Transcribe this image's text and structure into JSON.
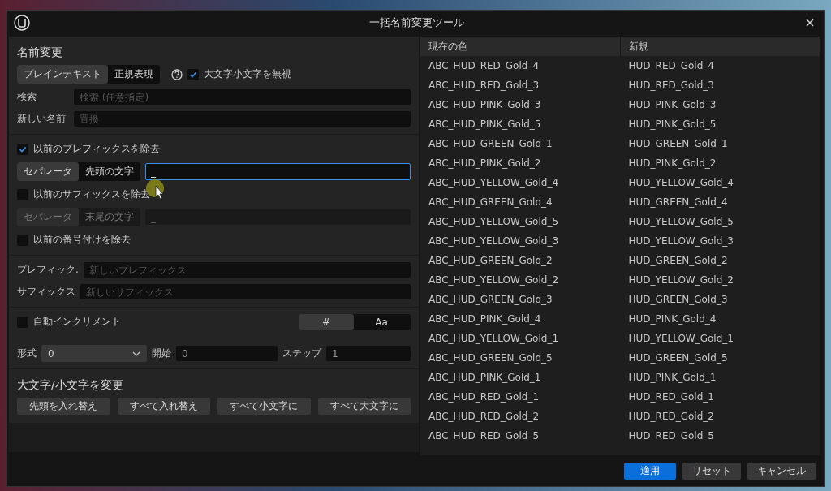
{
  "window": {
    "title": "一括名前変更ツール"
  },
  "rename": {
    "heading": "名前変更",
    "modes": [
      {
        "label": "プレインテキスト",
        "selected": true
      },
      {
        "label": "正規表現",
        "selected": false
      }
    ],
    "ignore_case": {
      "label": "大文字小文字を無視",
      "checked": true
    },
    "fields": [
      {
        "label": "検索",
        "placeholder": "検索 (任意指定)"
      },
      {
        "label": "新しい名前",
        "placeholder": "置換"
      }
    ]
  },
  "remove_prefix": {
    "label": "以前のプレフィックスを除去",
    "checked": true,
    "modes": [
      {
        "label": "セパレータ",
        "selected": true
      },
      {
        "label": "先頭の文字",
        "selected": false
      }
    ],
    "value": "_",
    "focused": true
  },
  "remove_suffix": {
    "label": "以前のサフィックスを除去",
    "checked": false,
    "modes": [
      {
        "label": "セパレータ",
        "selected": true
      },
      {
        "label": "末尾の文字",
        "selected": false
      }
    ],
    "value": "_",
    "focused": false
  },
  "remove_numbering": {
    "label": "以前の番号付けを除去",
    "checked": false
  },
  "affix_fields": [
    {
      "label": "プレフィック.",
      "placeholder": "新しいプレフィックス"
    },
    {
      "label": "サフィックス",
      "placeholder": "新しいサフィックス"
    }
  ],
  "auto_increment": {
    "label": "自動インクリメント",
    "checked": false,
    "modes": [
      {
        "label": "#",
        "selected": true
      },
      {
        "label": "Aa",
        "selected": false
      }
    ],
    "format": {
      "label": "形式",
      "value": "0"
    },
    "start": {
      "label": "開始",
      "value": "0"
    },
    "step": {
      "label": "ステップ",
      "value": "1"
    }
  },
  "case_change": {
    "heading": "大文字/小文字を変更",
    "buttons": [
      "先頭を入れ替え",
      "すべて入れ替え",
      "すべて小文字に",
      "すべて大文字に"
    ]
  },
  "table": {
    "columns": [
      "現在の色",
      "新規"
    ],
    "rows": [
      [
        "ABC_HUD_RED_Gold_4",
        "HUD_RED_Gold_4"
      ],
      [
        "ABC_HUD_RED_Gold_3",
        "HUD_RED_Gold_3"
      ],
      [
        "ABC_HUD_PINK_Gold_3",
        "HUD_PINK_Gold_3"
      ],
      [
        "ABC_HUD_PINK_Gold_5",
        "HUD_PINK_Gold_5"
      ],
      [
        "ABC_HUD_GREEN_Gold_1",
        "HUD_GREEN_Gold_1"
      ],
      [
        "ABC_HUD_PINK_Gold_2",
        "HUD_PINK_Gold_2"
      ],
      [
        "ABC_HUD_YELLOW_Gold_4",
        "HUD_YELLOW_Gold_4"
      ],
      [
        "ABC_HUD_GREEN_Gold_4",
        "HUD_GREEN_Gold_4"
      ],
      [
        "ABC_HUD_YELLOW_Gold_5",
        "HUD_YELLOW_Gold_5"
      ],
      [
        "ABC_HUD_YELLOW_Gold_3",
        "HUD_YELLOW_Gold_3"
      ],
      [
        "ABC_HUD_GREEN_Gold_2",
        "HUD_GREEN_Gold_2"
      ],
      [
        "ABC_HUD_YELLOW_Gold_2",
        "HUD_YELLOW_Gold_2"
      ],
      [
        "ABC_HUD_GREEN_Gold_3",
        "HUD_GREEN_Gold_3"
      ],
      [
        "ABC_HUD_PINK_Gold_4",
        "HUD_PINK_Gold_4"
      ],
      [
        "ABC_HUD_YELLOW_Gold_1",
        "HUD_YELLOW_Gold_1"
      ],
      [
        "ABC_HUD_GREEN_Gold_5",
        "HUD_GREEN_Gold_5"
      ],
      [
        "ABC_HUD_PINK_Gold_1",
        "HUD_PINK_Gold_1"
      ],
      [
        "ABC_HUD_RED_Gold_1",
        "HUD_RED_Gold_1"
      ],
      [
        "ABC_HUD_RED_Gold_2",
        "HUD_RED_Gold_2"
      ],
      [
        "ABC_HUD_RED_Gold_5",
        "HUD_RED_Gold_5"
      ]
    ]
  },
  "buttons": [
    {
      "label": "適用",
      "kind": "primary"
    },
    {
      "label": "リセット",
      "kind": "normal"
    },
    {
      "label": "キャンセル",
      "kind": "normal"
    }
  ]
}
